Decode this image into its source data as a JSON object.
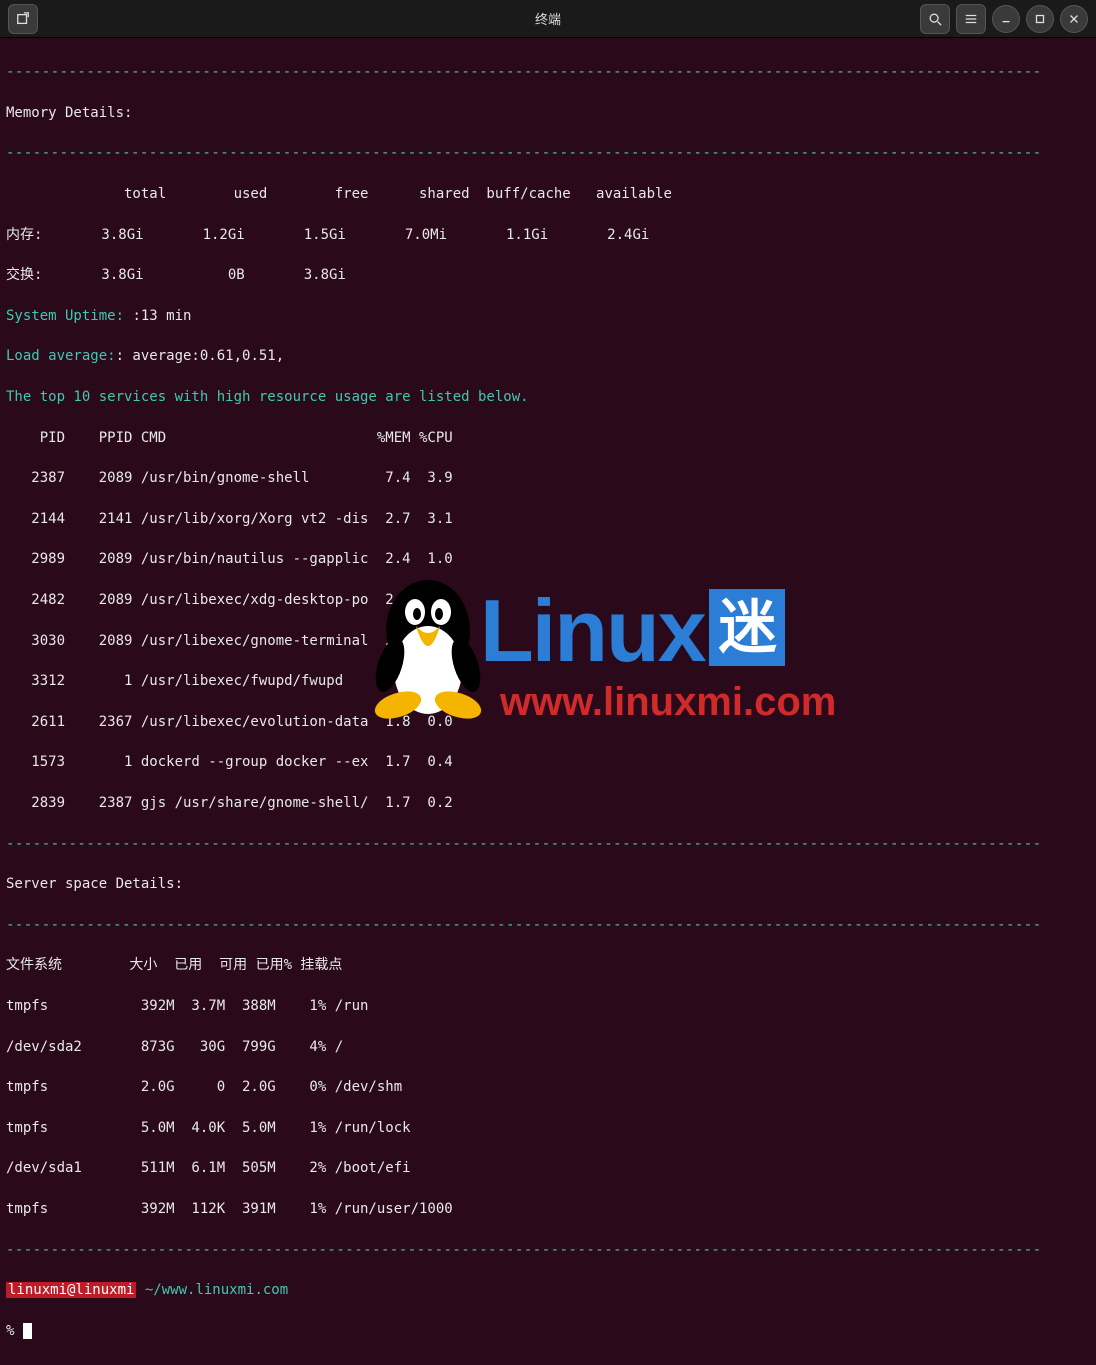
{
  "titlebar": {
    "title": "终端"
  },
  "dashes": "--------------------------------------------------------------------------------------------------------------------",
  "section_memory": "Memory Details:",
  "mem_header": "              total        used        free      shared  buff/cache   available",
  "mem_row": "内存:       3.8Gi       1.2Gi       1.5Gi       7.0Mi       1.1Gi       2.4Gi",
  "swap_row": "交换:       3.8Gi          0B       3.8Gi",
  "uptime_label": "System Uptime: ",
  "uptime_value": ":13 min",
  "loadavg_label": "Load average:",
  "loadavg_value": ": average:0.61,0.51,",
  "top10": "The top 10 services with high resource usage are listed below.",
  "proc_header": "    PID    PPID CMD                         %MEM %CPU",
  "procs": [
    "   2387    2089 /usr/bin/gnome-shell         7.4  3.9",
    "   2144    2141 /usr/lib/xorg/Xorg vt2 -dis  2.7  3.1",
    "   2989    2089 /usr/bin/nautilus --gapplic  2.4  1.0",
    "   2482    2089 /usr/libexec/xdg-desktop-po  2.1  0.1",
    "   3030    2089 /usr/libexec/gnome-terminal  2.0  1.5",
    "   3312       1 /usr/libexec/fwupd/fwupd     1.8  1.4",
    "   2611    2367 /usr/libexec/evolution-data  1.8  0.0",
    "   1573       1 dockerd --group docker --ex  1.7  0.4",
    "   2839    2387 gjs /usr/share/gnome-shell/  1.7  0.2"
  ],
  "section_space": "Server space Details:",
  "fs_header": "文件系统        大小  已用  可用 已用% 挂载点",
  "fs_rows": [
    "tmpfs           392M  3.7M  388M    1% /run",
    "/dev/sda2       873G   30G  799G    4% /",
    "tmpfs           2.0G     0  2.0G    0% /dev/shm",
    "tmpfs           5.0M  4.0K  5.0M    1% /run/lock",
    "/dev/sda1       511M  6.1M  505M    2% /boot/efi",
    "tmpfs           392M  112K  391M    1% /run/user/1000"
  ],
  "prompt": {
    "user": "linuxmi@linuxmi",
    "path": " ~/www.linuxmi.com",
    "line2": "% "
  },
  "overlay": {
    "brand": "Linux",
    "brand_cn": "迷",
    "url": "www.linuxmi.com"
  }
}
